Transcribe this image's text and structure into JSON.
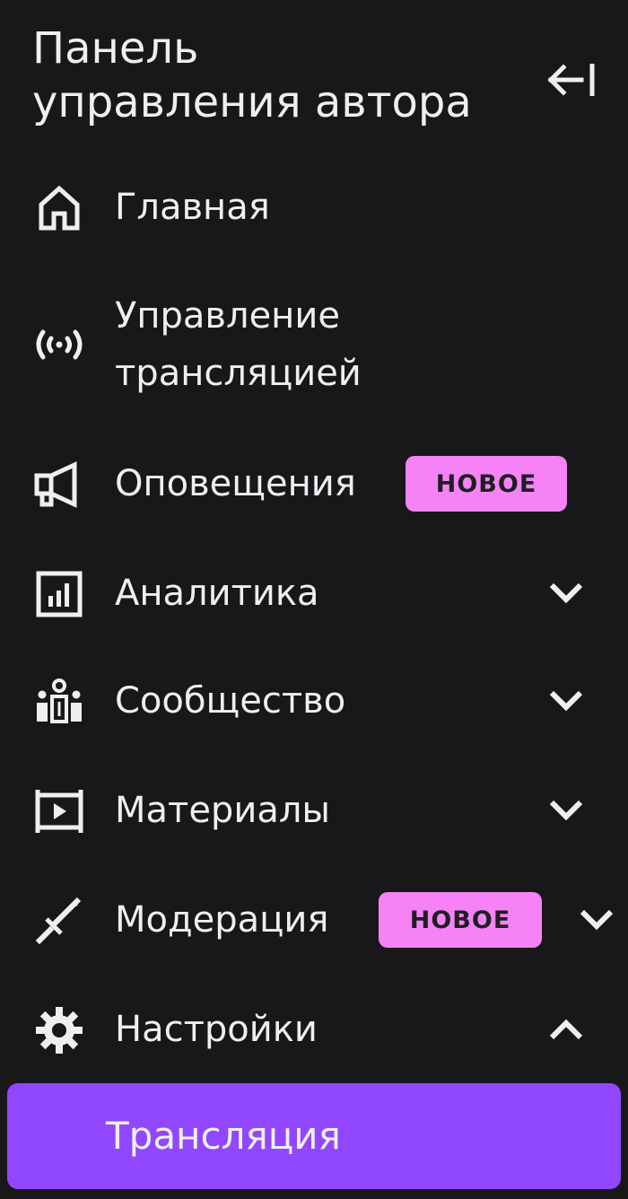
{
  "header": {
    "title_line1": "Панель",
    "title_line2": "управления автора",
    "collapse_icon": "collapse-left-icon"
  },
  "nav": {
    "home": {
      "label": "Главная",
      "icon": "home-icon"
    },
    "stream_manager": {
      "label_line1": "Управление",
      "label_line2": "трансляцией",
      "icon": "broadcast-icon"
    },
    "alerts": {
      "label": "Оповещения",
      "badge": "НОВОЕ",
      "icon": "megaphone-icon"
    },
    "analytics": {
      "label": "Аналитика",
      "icon": "analytics-icon",
      "expanded": false
    },
    "community": {
      "label": "Сообщество",
      "icon": "community-icon",
      "expanded": false
    },
    "content": {
      "label": "Материалы",
      "icon": "content-icon",
      "expanded": false
    },
    "moderation": {
      "label": "Модерация",
      "badge": "НОВОЕ",
      "icon": "sword-icon",
      "expanded": false
    },
    "settings": {
      "label": "Настройки",
      "icon": "gear-icon",
      "expanded": true
    },
    "settings_sub": {
      "label": "Трансляция"
    }
  },
  "colors": {
    "background": "#18181b",
    "text": "#efeff1",
    "badge": "#f583f5",
    "active": "#9147ff"
  }
}
